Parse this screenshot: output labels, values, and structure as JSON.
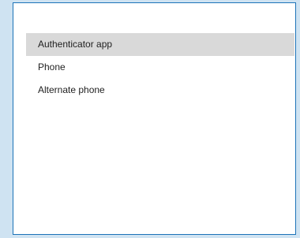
{
  "dropdown": {
    "options": [
      {
        "label": "Authenticator app",
        "selected": true
      },
      {
        "label": "Phone",
        "selected": false
      },
      {
        "label": "Alternate phone",
        "selected": false
      }
    ]
  },
  "colors": {
    "background": "#cfe3f2",
    "panel_border": "#1c73b8",
    "selected_background": "#d9d9d9",
    "text": "#1f1f1f"
  }
}
